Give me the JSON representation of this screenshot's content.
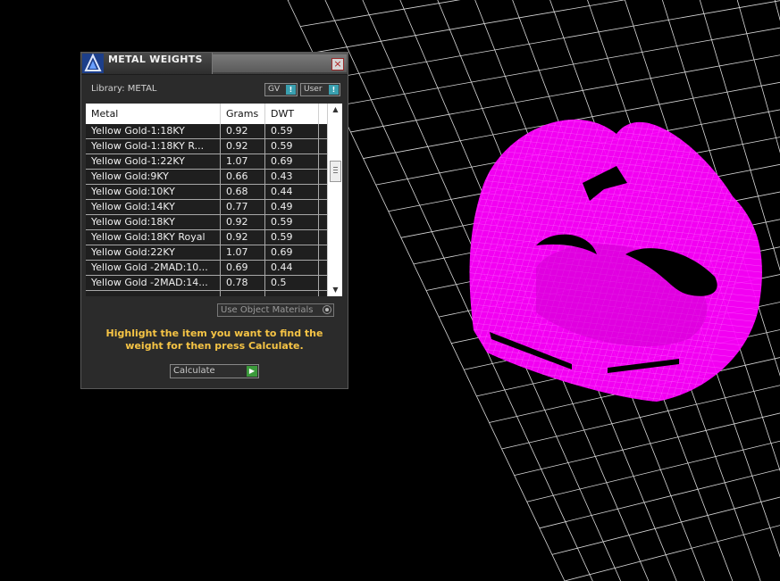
{
  "panel": {
    "title": "METAL WEIGHTS",
    "close_glyph": "×",
    "library_label": "Library: METAL",
    "toggles": [
      {
        "label": "GV",
        "indicator": "!"
      },
      {
        "label": "User",
        "indicator": "!"
      }
    ],
    "table": {
      "headers": [
        "Metal",
        "Grams",
        "DWT"
      ],
      "rows": [
        {
          "metal": "Yellow Gold-1:18KY",
          "grams": "0.92",
          "dwt": "0.59"
        },
        {
          "metal": "Yellow Gold-1:18KY R...",
          "grams": "0.92",
          "dwt": "0.59"
        },
        {
          "metal": "Yellow Gold-1:22KY",
          "grams": "1.07",
          "dwt": "0.69"
        },
        {
          "metal": "Yellow Gold:9KY",
          "grams": "0.66",
          "dwt": "0.43"
        },
        {
          "metal": "Yellow Gold:10KY",
          "grams": "0.68",
          "dwt": "0.44"
        },
        {
          "metal": "Yellow Gold:14KY",
          "grams": "0.77",
          "dwt": "0.49"
        },
        {
          "metal": "Yellow Gold:18KY",
          "grams": "0.92",
          "dwt": "0.59"
        },
        {
          "metal": "Yellow Gold:18KY Royal",
          "grams": "0.92",
          "dwt": "0.59"
        },
        {
          "metal": "Yellow Gold:22KY",
          "grams": "1.07",
          "dwt": "0.69"
        },
        {
          "metal": "Yellow Gold -2MAD:10...",
          "grams": "0.69",
          "dwt": "0.44"
        },
        {
          "metal": "Yellow Gold -2MAD:14...",
          "grams": "0.78",
          "dwt": "0.5"
        }
      ]
    },
    "use_object_materials": "Use Object Materials",
    "hint": "Highlight the item you want to find the weight for then press Calculate.",
    "calculate_label": "Calculate"
  },
  "colors": {
    "hint": "#f6c445",
    "mesh": "#ff00ff",
    "grid": "#ffffff"
  }
}
